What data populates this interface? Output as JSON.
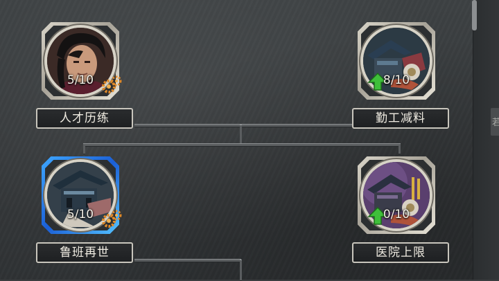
{
  "talent_tree": {
    "nodes": [
      {
        "name": "人才历练",
        "progress": "5/10",
        "icon": "hero-portrait-icon",
        "gear": true
      },
      {
        "name": "勤工减料",
        "progress": "8/10",
        "icon": "workshop-building-icon",
        "upgrade": true
      },
      {
        "name": "鲁班再世",
        "progress": "5/10",
        "icon": "palace-building-icon",
        "gear": true,
        "selected": true
      },
      {
        "name": "医院上限",
        "progress": "0/10",
        "icon": "hospital-building-icon",
        "upgrade": true
      }
    ]
  },
  "side_panel": {
    "glyph": "若"
  },
  "colors": {
    "selected_glow": "#2f8cff",
    "upgrade_green": "#3fbf3a",
    "gear_orange": "#e08a2a"
  }
}
